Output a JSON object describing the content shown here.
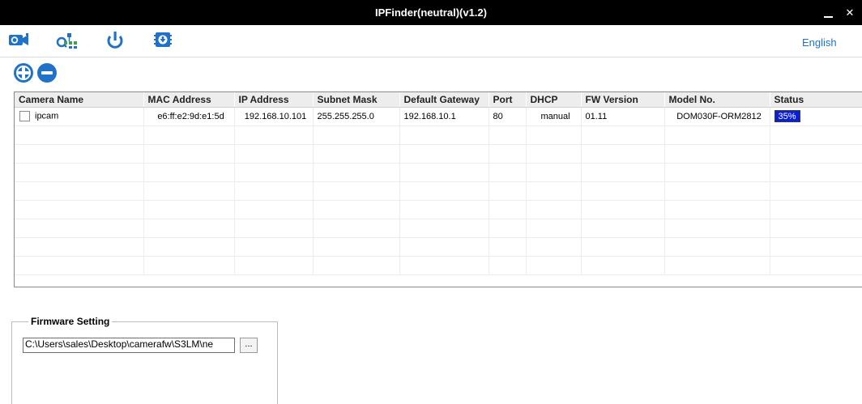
{
  "window": {
    "title": "IPFinder(neutral)(v1.2)",
    "minimize_label": "_",
    "close_label": "✕"
  },
  "toolbar": {
    "icons": [
      "camera-search-icon",
      "network-config-icon",
      "reboot-icon",
      "firmware-upgrade-icon"
    ],
    "language": "English",
    "accent_color": "#1f72c7"
  },
  "actions": {
    "add_icon": "plus-circle-icon",
    "remove_icon": "minus-circle-icon"
  },
  "table": {
    "columns": [
      "Camera Name",
      "MAC Address",
      "IP Address",
      "Subnet Mask",
      "Default Gateway",
      "Port",
      "DHCP",
      "FW Version",
      "Model No.",
      "Status"
    ],
    "rows": [
      {
        "camera_name": "ipcam",
        "mac": "e6:ff:e2:9d:e1:5d",
        "ip": "192.168.10.101",
        "subnet": "255.255.255.0",
        "gateway": "192.168.10.1",
        "port": "80",
        "dhcp": "manual",
        "fw_version": "01.11",
        "model": "DOM030F-ORM2812",
        "status": "35%",
        "status_color": "#0b1fd6"
      }
    ]
  },
  "firmware": {
    "legend": "Firmware Setting",
    "path": "C:\\Users\\sales\\Desktop\\camerafw\\S3LM\\ne",
    "browse_label": "..."
  }
}
